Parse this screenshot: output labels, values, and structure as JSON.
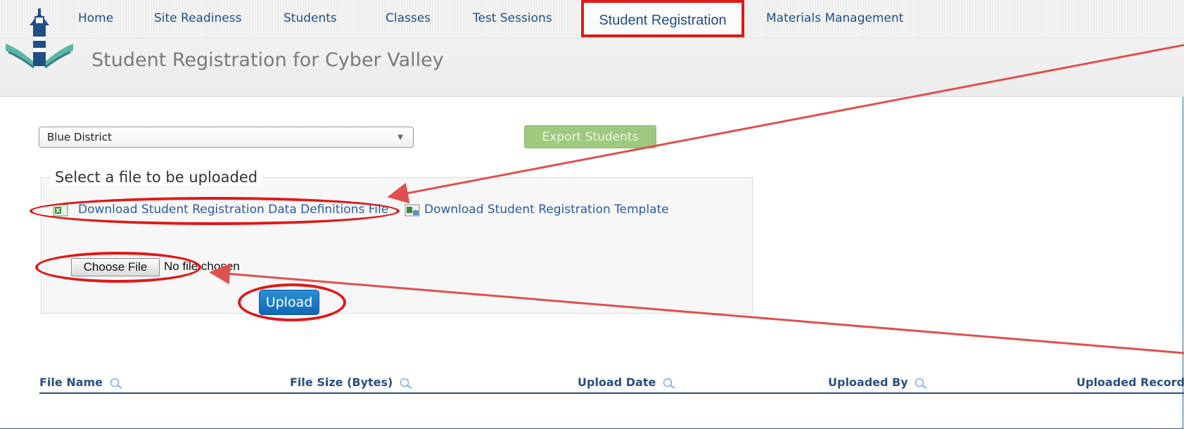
{
  "nav": {
    "items": [
      "Home",
      "Site Readiness",
      "Students",
      "Classes",
      "Test Sessions"
    ],
    "active": "Student Registration",
    "after": "Materials Management"
  },
  "page": {
    "title": "Student Registration for Cyber Valley"
  },
  "district_select": {
    "value": "Blue District"
  },
  "export": {
    "label": "Export Students"
  },
  "upload_section": {
    "legend": "Select a file to be uploaded",
    "download_definitions": "Download Student Registration Data Definitions File",
    "download_template": "Download Student Registration Template",
    "choose_file": "Choose File",
    "no_file": "No file chosen",
    "upload": "Upload"
  },
  "table": {
    "columns": [
      "File Name",
      "File Size (Bytes)",
      "Upload Date",
      "Uploaded By",
      "Uploaded Records"
    ]
  },
  "colors": {
    "nav_text": "#1f4f86",
    "highlight": "#e01818",
    "export_bg": "#9ec97f",
    "upload_bg": "#1a7bc6"
  }
}
